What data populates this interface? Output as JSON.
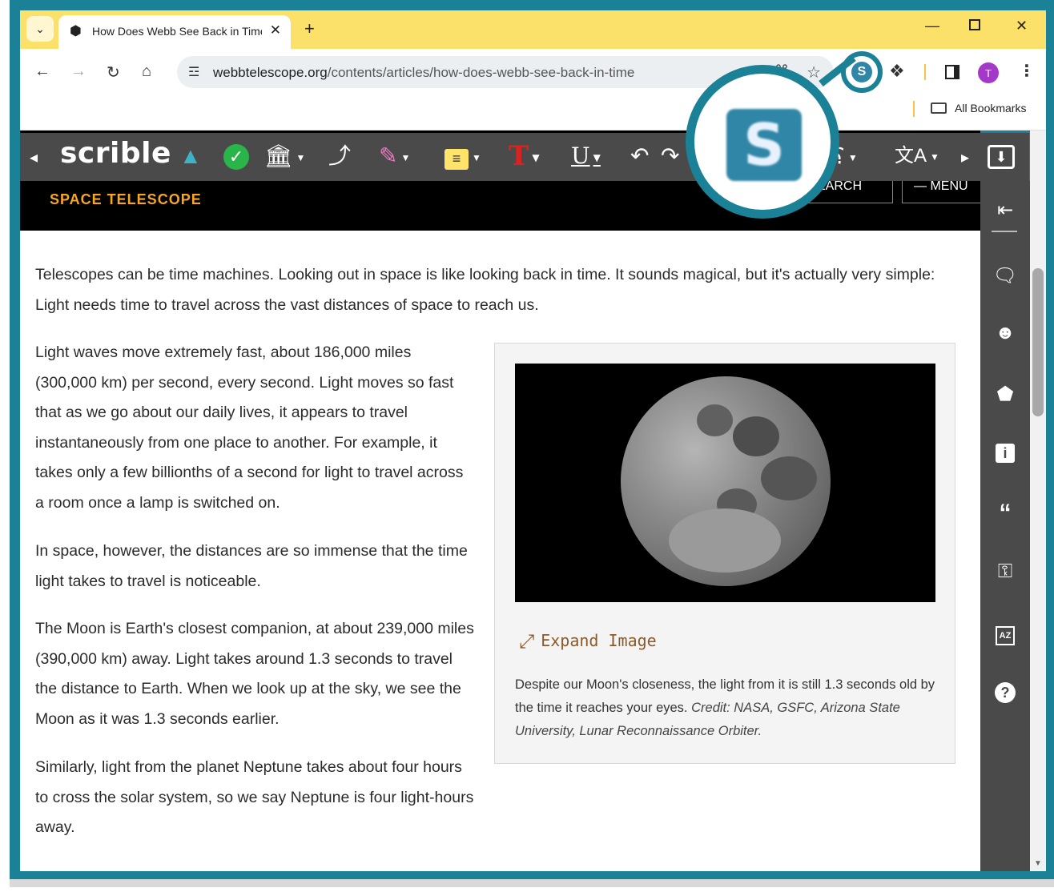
{
  "browser": {
    "tab_title": "How Does Webb See Back in Time",
    "tab_list_icon": "chevron-down",
    "new_tab": "+",
    "url_domain": "webbtelescope.org",
    "url_path": "/contents/articles/how-does-webb-see-back-in-time",
    "all_bookmarks": "All Bookmarks",
    "profile_initial": "T",
    "colors": {
      "tabbar": "#fbe06a",
      "frame": "#1a8196"
    }
  },
  "site": {
    "logo_sub": "SPACE TELESCOPE",
    "search_btn": "EARCH",
    "menu_btn": "MENU"
  },
  "scrible": {
    "logo": "scrible",
    "extension_letter": "S"
  },
  "article": {
    "p1": "Telescopes can be time machines. Looking out in space is like looking back in time. It sounds magical, but it's actually very simple: Light needs time to travel across the vast distances of space to reach us.",
    "p2": "Light waves move extremely fast, about 186,000 miles (300,000 km) per second, every second. Light moves so fast that as we go about our daily lives, it appears to travel instantaneously from one place to another. For example, it takes only a few billionths of a second for light to travel across a room once a lamp is switched on.",
    "p3": "In space, however, the distances are so immense that the time light takes to travel is noticeable.",
    "p4": "The Moon is Earth's closest companion, at about 239,000 miles (390,000 km) away. Light takes around 1.3 seconds to travel the distance to Earth. When we look up at the sky, we see the Moon as it was 1.3 seconds earlier.",
    "p5": "Similarly, light from the planet Neptune takes about four hours to cross the solar system, so we say Neptune is four light-hours away.",
    "expand_label": "Expand Image",
    "caption_main": "Despite our Moon's closeness, the light from it is still 1.3 seconds old by the time it reaches your eyes. ",
    "caption_credit": "Credit: NASA, GSFC, Arizona State University, Lunar Reconnaissance Orbiter."
  }
}
